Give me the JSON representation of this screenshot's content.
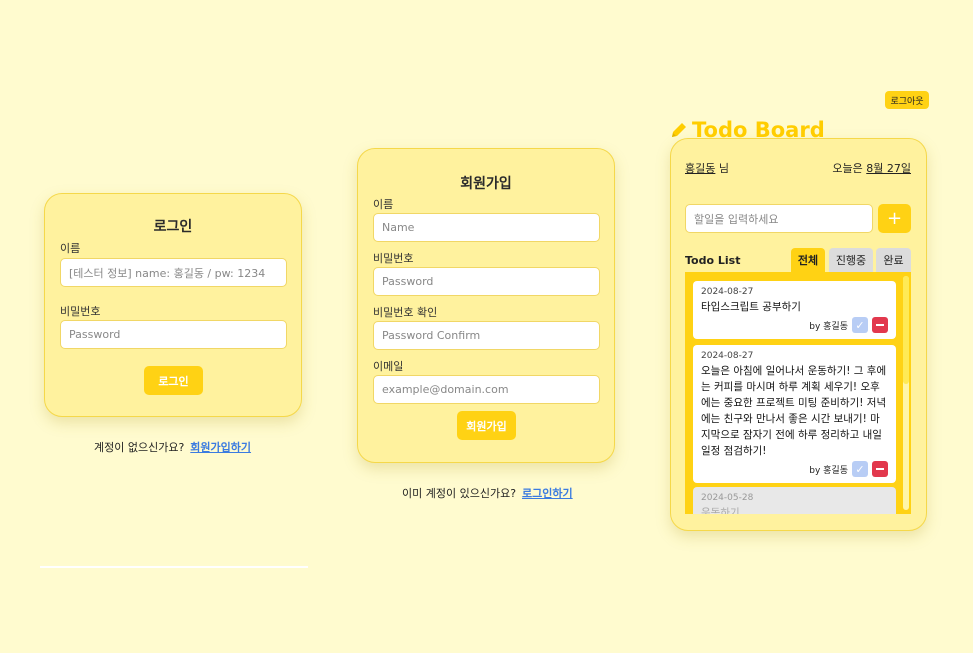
{
  "login": {
    "title": "로그인",
    "name_label": "이름",
    "name_placeholder": "[테스터 정보] name: 홍길동 / pw: 1234",
    "password_label": "비밀번호",
    "password_placeholder": "Password",
    "submit_label": "로그인",
    "footer_text": "계정이 없으신가요?",
    "footer_link": "회원가입하기"
  },
  "signup": {
    "title": "회원가입",
    "name_label": "이름",
    "name_placeholder": "Name",
    "password_label": "비밀번호",
    "password_placeholder": "Password",
    "confirm_label": "비밀번호 확인",
    "confirm_placeholder": "Password Confirm",
    "email_label": "이메일",
    "email_placeholder": "example@domain.com",
    "submit_label": "회원가입",
    "footer_text": "이미 계정이 있으신가요?",
    "footer_link": "로그인하기"
  },
  "todo": {
    "logout_label": "로그아웃",
    "title": "Todo Board",
    "user_name": "홍길동",
    "user_suffix": "님",
    "date_prefix": "오늘은",
    "date_value": "8월 27일",
    "input_placeholder": "할일을 입력하세요",
    "add_label": "+",
    "list_title": "Todo List",
    "tabs": [
      {
        "label": "전체",
        "active": true
      },
      {
        "label": "진행중",
        "active": false
      },
      {
        "label": "완료",
        "active": false
      }
    ],
    "items": [
      {
        "date": "2024-08-27",
        "text": "타입스크립트 공부하기",
        "by": "by 홍길동"
      },
      {
        "date": "2024-08-27",
        "text": "오늘은 아침에 일어나서 운동하기! 그 후에는 커피를 마시며 하루 계획 세우기! 오후에는 중요한 프로젝트 미팅 준비하기! 저녁에는 친구와 만나서 좋은 시간 보내기! 마지막으로 잠자기 전에 하루 정리하고 내일 일정 점검하기!",
        "by": "by 홍길동"
      },
      {
        "date": "2024-05-28",
        "text": "운동하기",
        "by": ""
      }
    ]
  },
  "colors": {
    "background": "#fffbcf",
    "card": "#fff29e",
    "accent": "#ffd214",
    "link": "#3b7be0",
    "delete": "#e2384d",
    "check": "#b8cdf5"
  }
}
